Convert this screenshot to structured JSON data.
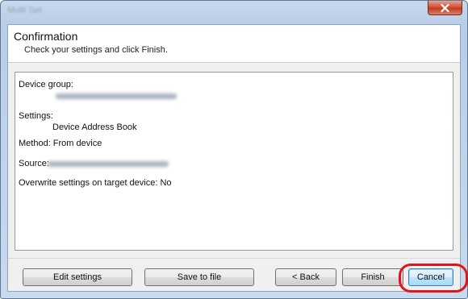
{
  "window": {
    "title": "Multi Set",
    "close_icon": "close-icon",
    "close_color": "#c74a33"
  },
  "header": {
    "title": "Confirmation",
    "subtitle": "Check your settings and click Finish."
  },
  "summary": {
    "device_group_label": "Device group:",
    "settings_label": "Settings:",
    "settings_value": "Device Address Book",
    "method": "Method: From device",
    "source_label": "Source:",
    "overwrite": "Overwrite settings on target device: No"
  },
  "footer": {
    "edit_settings": "Edit settings",
    "save_to_file": "Save to file",
    "back": "< Back",
    "finish": "Finish",
    "cancel": "Cancel"
  },
  "colors": {
    "highlight": "#e1141b",
    "title_bar": "#b9cde6"
  }
}
